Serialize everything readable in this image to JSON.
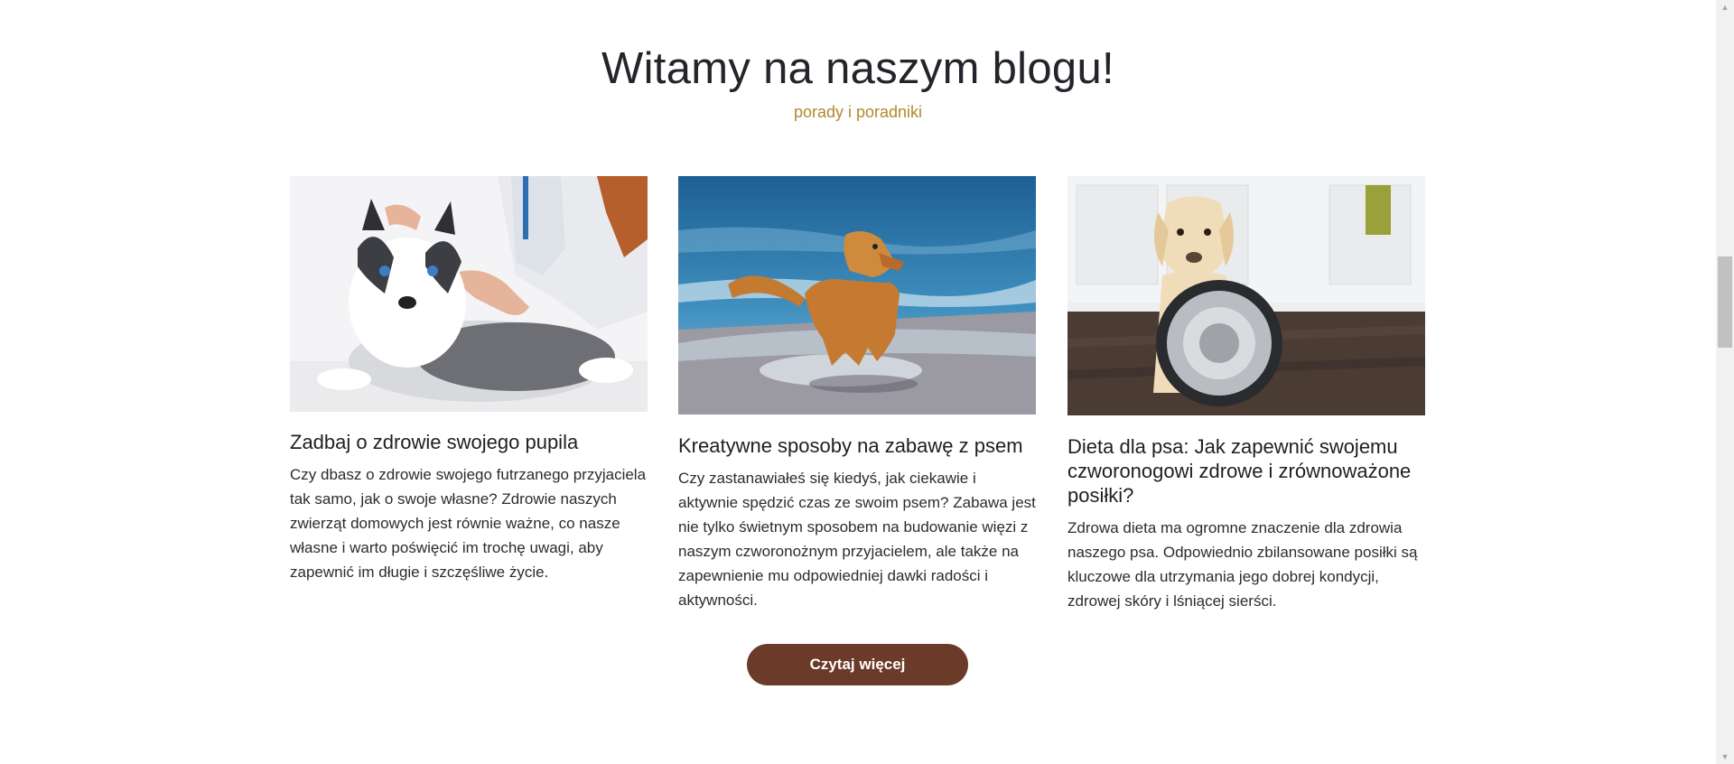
{
  "section": {
    "title": "Witamy na naszym blogu!",
    "subtitle": "porady i poradniki"
  },
  "posts": [
    {
      "image_alt": "husky puppy at the vet",
      "title": "Zadbaj o zdrowie swojego pupila",
      "excerpt": "Czy dbasz o zdrowie swojego futrzanego przyjaciela tak samo, jak o swoje własne? Zdrowie naszych zwierząt domowych jest równie ważne, co nasze własne i warto poświęcić im trochę uwagi, aby zapewnić im długie i szczęśliwe życie."
    },
    {
      "image_alt": "golden retriever running on a beach",
      "title": "Kreatywne sposoby na zabawę z psem",
      "excerpt": "Czy zastanawiałeś się kiedyś, jak ciekawie i aktywnie spędzić czas ze swoim psem? Zabawa jest nie tylko świetnym sposobem na budowanie więzi z naszym czworonożnym przyjacielem, ale także na zapewnienie mu odpowiedniej dawki radości i aktywności."
    },
    {
      "image_alt": "labrador holding a metal food bowl in a kitchen",
      "title": "Dieta dla psa: Jak zapewnić swojemu czworonogowi zdrowe i zrównoważone posiłki?",
      "excerpt": "Zdrowa dieta ma ogromne znaczenie dla zdrowia naszego psa. Odpowiednio zbilansowane posiłki są kluczowe dla utrzymania jego dobrej kondycji, zdrowej skóry i lśniącej sierści."
    }
  ],
  "cta": {
    "label": "Czytaj więcej"
  },
  "colors": {
    "accent": "#b08a2e",
    "button": "#6b3a28",
    "heading": "#23252a"
  },
  "icons": {
    "scroll_up": "chevron-up-icon",
    "scroll_down": "chevron-down-icon"
  }
}
